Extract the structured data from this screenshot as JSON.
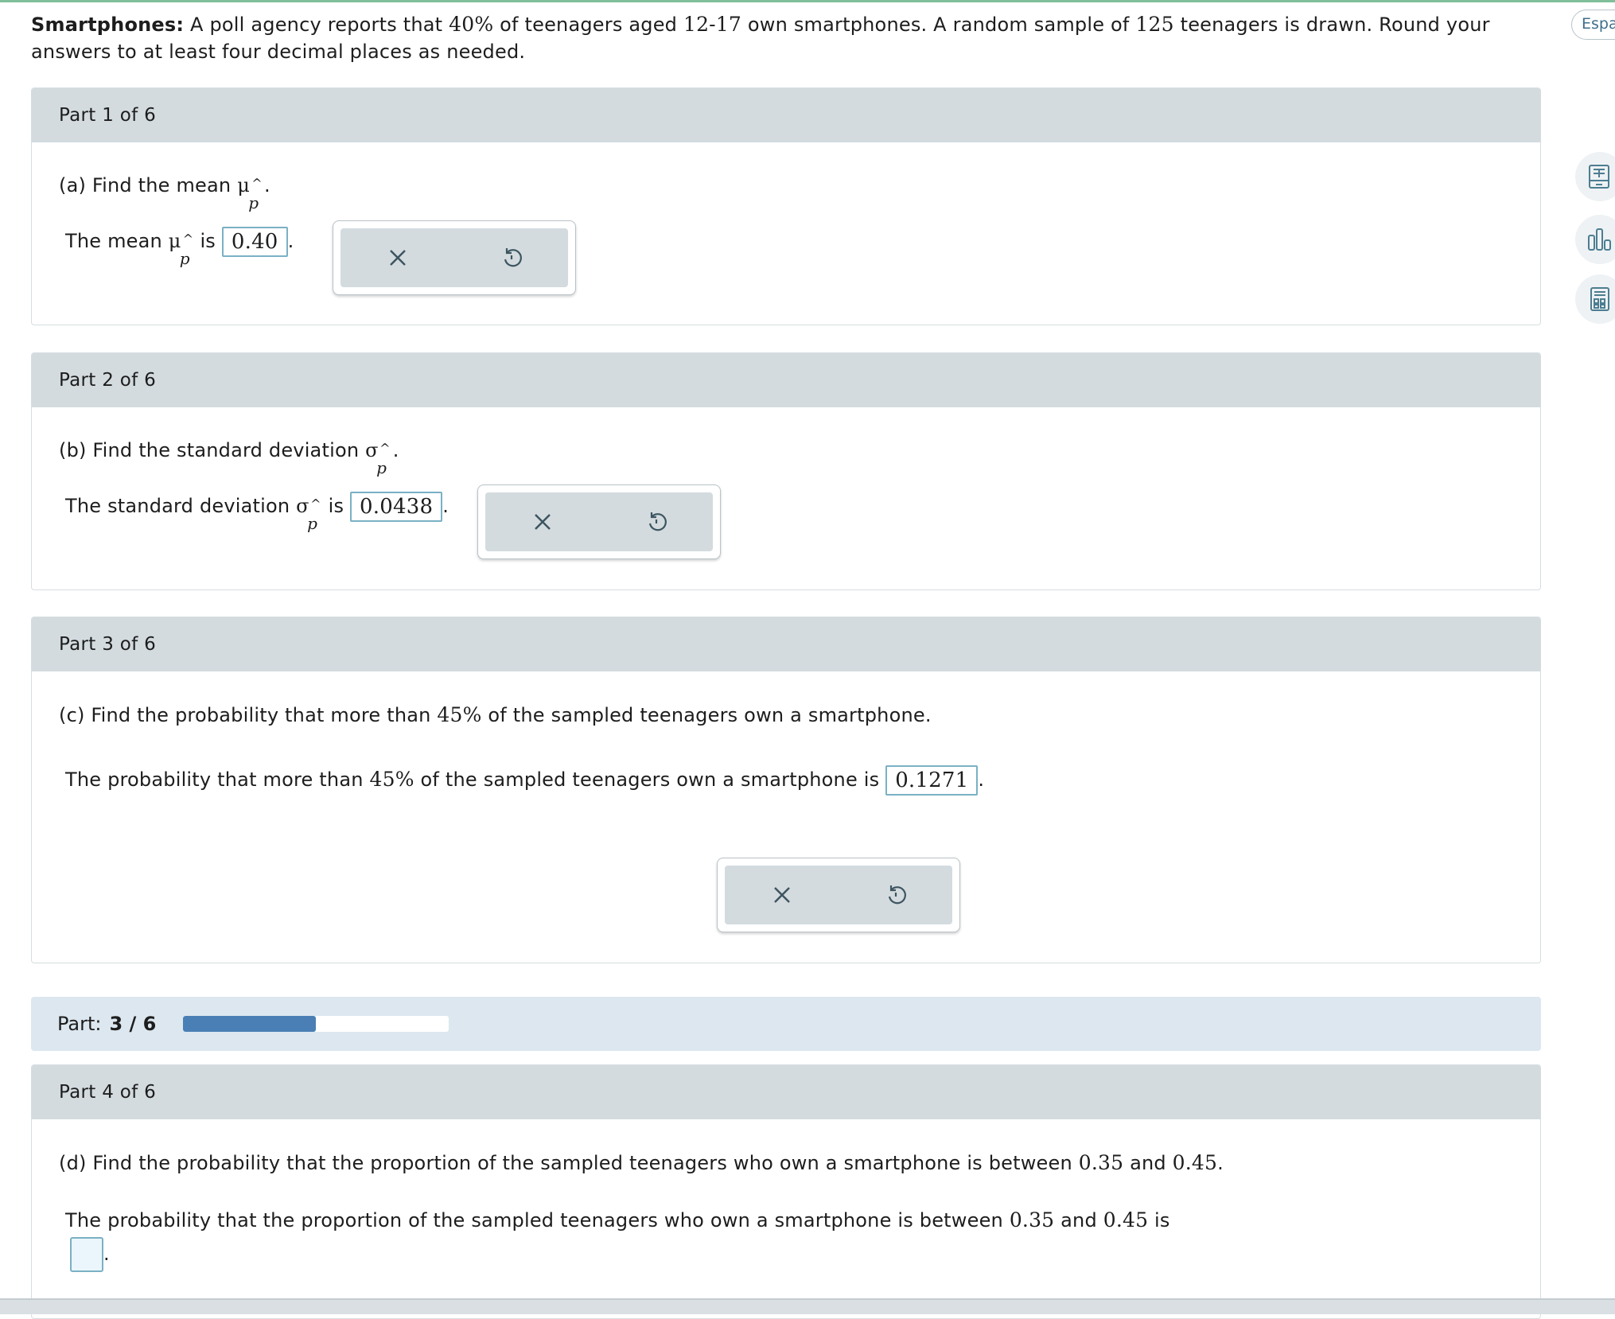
{
  "intro": {
    "title": "Smartphones:",
    "text_a": "A poll agency reports that",
    "pct": "40%",
    "text_b": "of teenagers aged",
    "ages": "12-17",
    "text_c": "own smartphones. A random sample of",
    "n": "125",
    "text_d": "teenagers is drawn. Round your answers to at least four decimal places as needed."
  },
  "language_toggle": "Espa",
  "symbols": {
    "mu": "μ",
    "sigma": "σ",
    "hat": "^",
    "sub": "p"
  },
  "parts": [
    {
      "header": "Part 1 of 6",
      "question_prefix": "(a) Find the mean",
      "question_suffix": ".",
      "answer_prefix": "The mean",
      "answer_mid": "is",
      "answer": "0.40",
      "answer_suffix": "."
    },
    {
      "header": "Part 2 of 6",
      "question_prefix": "(b) Find the standard deviation",
      "question_suffix": ".",
      "answer_prefix": "The standard deviation",
      "answer_mid": "is",
      "answer": "0.0438",
      "answer_suffix": "."
    },
    {
      "header": "Part 3 of 6",
      "question_prefix": "(c) Find the probability that more than",
      "question_num": "45%",
      "question_suffix": "of the sampled teenagers own a smartphone.",
      "answer_prefix": "The probability that more than",
      "answer_num": "45%",
      "answer_mid": "of the sampled teenagers own a smartphone is",
      "answer": "0.1271",
      "answer_suffix": "."
    },
    {
      "header": "Part 4 of 6",
      "question_prefix": "(d) Find the probability that the proportion of the sampled teenagers who own a smartphone is between",
      "q_low": "0.35",
      "q_and": "and",
      "q_high": "0.45",
      "question_suffix": ".",
      "answer_prefix": "The probability that the proportion of the sampled teenagers who own a smartphone is between",
      "a_low": "0.35",
      "a_and": "and",
      "a_high": "0.45",
      "answer_mid": "is",
      "answer": "",
      "answer_suffix": "."
    }
  ],
  "progress": {
    "label": "Part:",
    "value": "3 / 6",
    "fraction": 0.5
  },
  "colors": {
    "accent": "#4a7fb5",
    "header_bg": "#d3dbdf",
    "input_border": "#7ab1c4",
    "progress_bg": "#dce7ef"
  },
  "icons": [
    "close-icon",
    "undo-icon",
    "ebook-icon",
    "bar-chart-icon",
    "calculator-icon"
  ]
}
